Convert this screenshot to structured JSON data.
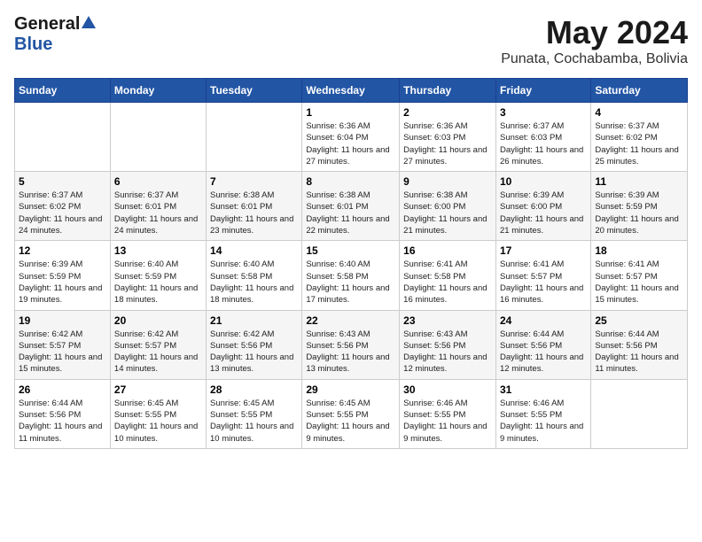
{
  "header": {
    "logo_general": "General",
    "logo_blue": "Blue",
    "month": "May 2024",
    "location": "Punata, Cochabamba, Bolivia"
  },
  "days_of_week": [
    "Sunday",
    "Monday",
    "Tuesday",
    "Wednesday",
    "Thursday",
    "Friday",
    "Saturday"
  ],
  "weeks": [
    [
      {
        "day": "",
        "info": ""
      },
      {
        "day": "",
        "info": ""
      },
      {
        "day": "",
        "info": ""
      },
      {
        "day": "1",
        "info": "Sunrise: 6:36 AM\nSunset: 6:04 PM\nDaylight: 11 hours and 27 minutes."
      },
      {
        "day": "2",
        "info": "Sunrise: 6:36 AM\nSunset: 6:03 PM\nDaylight: 11 hours and 27 minutes."
      },
      {
        "day": "3",
        "info": "Sunrise: 6:37 AM\nSunset: 6:03 PM\nDaylight: 11 hours and 26 minutes."
      },
      {
        "day": "4",
        "info": "Sunrise: 6:37 AM\nSunset: 6:02 PM\nDaylight: 11 hours and 25 minutes."
      }
    ],
    [
      {
        "day": "5",
        "info": "Sunrise: 6:37 AM\nSunset: 6:02 PM\nDaylight: 11 hours and 24 minutes."
      },
      {
        "day": "6",
        "info": "Sunrise: 6:37 AM\nSunset: 6:01 PM\nDaylight: 11 hours and 24 minutes."
      },
      {
        "day": "7",
        "info": "Sunrise: 6:38 AM\nSunset: 6:01 PM\nDaylight: 11 hours and 23 minutes."
      },
      {
        "day": "8",
        "info": "Sunrise: 6:38 AM\nSunset: 6:01 PM\nDaylight: 11 hours and 22 minutes."
      },
      {
        "day": "9",
        "info": "Sunrise: 6:38 AM\nSunset: 6:00 PM\nDaylight: 11 hours and 21 minutes."
      },
      {
        "day": "10",
        "info": "Sunrise: 6:39 AM\nSunset: 6:00 PM\nDaylight: 11 hours and 21 minutes."
      },
      {
        "day": "11",
        "info": "Sunrise: 6:39 AM\nSunset: 5:59 PM\nDaylight: 11 hours and 20 minutes."
      }
    ],
    [
      {
        "day": "12",
        "info": "Sunrise: 6:39 AM\nSunset: 5:59 PM\nDaylight: 11 hours and 19 minutes."
      },
      {
        "day": "13",
        "info": "Sunrise: 6:40 AM\nSunset: 5:59 PM\nDaylight: 11 hours and 18 minutes."
      },
      {
        "day": "14",
        "info": "Sunrise: 6:40 AM\nSunset: 5:58 PM\nDaylight: 11 hours and 18 minutes."
      },
      {
        "day": "15",
        "info": "Sunrise: 6:40 AM\nSunset: 5:58 PM\nDaylight: 11 hours and 17 minutes."
      },
      {
        "day": "16",
        "info": "Sunrise: 6:41 AM\nSunset: 5:58 PM\nDaylight: 11 hours and 16 minutes."
      },
      {
        "day": "17",
        "info": "Sunrise: 6:41 AM\nSunset: 5:57 PM\nDaylight: 11 hours and 16 minutes."
      },
      {
        "day": "18",
        "info": "Sunrise: 6:41 AM\nSunset: 5:57 PM\nDaylight: 11 hours and 15 minutes."
      }
    ],
    [
      {
        "day": "19",
        "info": "Sunrise: 6:42 AM\nSunset: 5:57 PM\nDaylight: 11 hours and 15 minutes."
      },
      {
        "day": "20",
        "info": "Sunrise: 6:42 AM\nSunset: 5:57 PM\nDaylight: 11 hours and 14 minutes."
      },
      {
        "day": "21",
        "info": "Sunrise: 6:42 AM\nSunset: 5:56 PM\nDaylight: 11 hours and 13 minutes."
      },
      {
        "day": "22",
        "info": "Sunrise: 6:43 AM\nSunset: 5:56 PM\nDaylight: 11 hours and 13 minutes."
      },
      {
        "day": "23",
        "info": "Sunrise: 6:43 AM\nSunset: 5:56 PM\nDaylight: 11 hours and 12 minutes."
      },
      {
        "day": "24",
        "info": "Sunrise: 6:44 AM\nSunset: 5:56 PM\nDaylight: 11 hours and 12 minutes."
      },
      {
        "day": "25",
        "info": "Sunrise: 6:44 AM\nSunset: 5:56 PM\nDaylight: 11 hours and 11 minutes."
      }
    ],
    [
      {
        "day": "26",
        "info": "Sunrise: 6:44 AM\nSunset: 5:56 PM\nDaylight: 11 hours and 11 minutes."
      },
      {
        "day": "27",
        "info": "Sunrise: 6:45 AM\nSunset: 5:55 PM\nDaylight: 11 hours and 10 minutes."
      },
      {
        "day": "28",
        "info": "Sunrise: 6:45 AM\nSunset: 5:55 PM\nDaylight: 11 hours and 10 minutes."
      },
      {
        "day": "29",
        "info": "Sunrise: 6:45 AM\nSunset: 5:55 PM\nDaylight: 11 hours and 9 minutes."
      },
      {
        "day": "30",
        "info": "Sunrise: 6:46 AM\nSunset: 5:55 PM\nDaylight: 11 hours and 9 minutes."
      },
      {
        "day": "31",
        "info": "Sunrise: 6:46 AM\nSunset: 5:55 PM\nDaylight: 11 hours and 9 minutes."
      },
      {
        "day": "",
        "info": ""
      }
    ]
  ]
}
